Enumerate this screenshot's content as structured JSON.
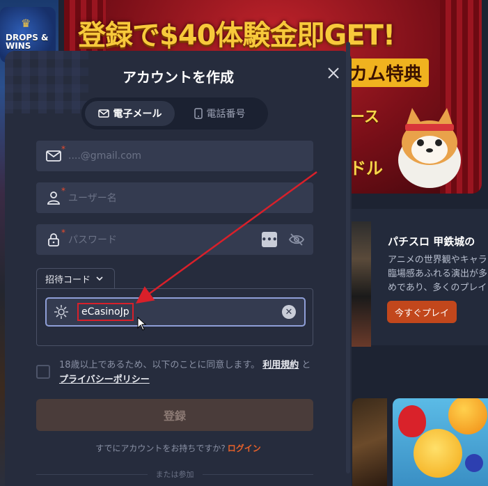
{
  "background": {
    "promo_tile": {
      "text": "DROPS & WINS"
    },
    "banner": {
      "headline": "登録で$40体験金即GET!",
      "sub": "カム特典",
      "side_text_1": "ース",
      "side_text_2": "ドル"
    },
    "game": {
      "title": "パチスロ 甲鉄城の",
      "description": "アニメの世界観やキャラ\n臨場感あふれる演出が多\nめであり、多くのプレイ",
      "play_label": "今すぐプレイ"
    }
  },
  "modal": {
    "title": "アカウントを作成",
    "close_icon": "close-icon",
    "tabs": [
      {
        "label": "電子メール",
        "icon": "mail-icon",
        "active": true
      },
      {
        "label": "電話番号",
        "icon": "phone-icon",
        "active": false
      }
    ],
    "fields": {
      "email": {
        "placeholder": "....@gmail.com",
        "required_mark": "*"
      },
      "username": {
        "placeholder": "ユーザー名",
        "required_mark": "*"
      },
      "password": {
        "placeholder": "パスワード",
        "required_mark": "*"
      }
    },
    "invite": {
      "tab_label": "招待コード",
      "code_value": "eCasinoJp"
    },
    "agreement": {
      "text_before": "18歳以上であるため、以下のことに同意します。",
      "terms_link": "利用規約",
      "conjunction": "と",
      "privacy_link": "プライバシーポリシー"
    },
    "register_label": "登録",
    "login_prompt": "すでにアカウントをお持ちですか?",
    "login_link": "ログイン",
    "or_text": "または参加"
  },
  "colors": {
    "modal_bg": "#262c3d",
    "field_bg": "#343b50",
    "accent_orange": "#e8612a",
    "required_red": "#e84b2c",
    "annotation_red": "#d9202a",
    "register_disabled": "#4a3c3a"
  }
}
